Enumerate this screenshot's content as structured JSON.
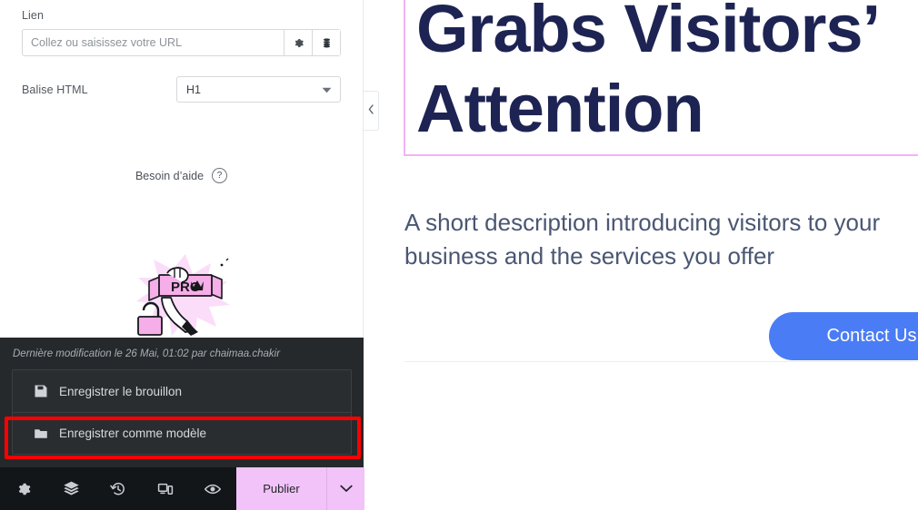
{
  "editor_panel": {
    "link": {
      "label": "Lien",
      "input_value": "",
      "placeholder": "Collez ou saisissez votre URL",
      "options_button_name": "link-options",
      "dynamic_button_name": "dynamic-tags"
    },
    "html_tag": {
      "label": "Balise HTML",
      "selected": "H1"
    },
    "help": {
      "label": "Besoin d’aide",
      "icon_glyph": "?"
    },
    "illustration": {
      "badge_text": "PRO"
    }
  },
  "save_panel": {
    "last_edited": "Dernière modification le 26 Mai, 01:02 par chaimaa.chakir",
    "options": [
      {
        "label": "Enregistrer le brouillon",
        "icon": "floppy-disk-icon"
      },
      {
        "label": "Enregistrer comme modèle",
        "icon": "folder-icon"
      }
    ],
    "highlighted_option_index": 1
  },
  "bottom_bar": {
    "tools": [
      {
        "name": "settings-icon",
        "title": "Paramètres"
      },
      {
        "name": "layers-icon",
        "title": "Navigateur"
      },
      {
        "name": "history-icon",
        "title": "Historique"
      },
      {
        "name": "responsive-icon",
        "title": "Mode responsive"
      },
      {
        "name": "eye-icon",
        "title": "Aperçu"
      }
    ],
    "publish_label": "Publier"
  },
  "preview": {
    "heading": "Grabs Visitors’\nAttention",
    "description": "A short description introducing visitors to your business and the services you offer",
    "cta_label": "Contact Us"
  },
  "colors": {
    "panel_background": "#ffffff",
    "dark_panel": "#26292c",
    "toolbar": "#131619",
    "publish_pink": "#f2c3f8",
    "annotation_red": "#fe0000",
    "selection_pink": "#f3b2f7",
    "heading_navy": "#1d2453",
    "description_slate": "#4a5773",
    "cta_blue": "#4a7cf5"
  }
}
